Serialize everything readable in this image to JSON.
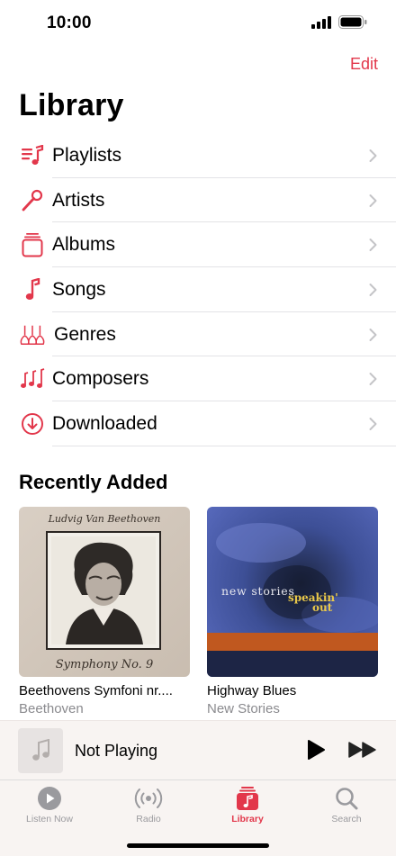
{
  "status": {
    "time": "10:00"
  },
  "header": {
    "edit_label": "Edit",
    "title": "Library"
  },
  "library_items": [
    {
      "label": "Playlists",
      "icon": "playlist-icon"
    },
    {
      "label": "Artists",
      "icon": "microphone-icon"
    },
    {
      "label": "Albums",
      "icon": "album-stack-icon"
    },
    {
      "label": "Songs",
      "icon": "music-note-icon"
    },
    {
      "label": "Genres",
      "icon": "guitars-icon"
    },
    {
      "label": "Composers",
      "icon": "notes-icon"
    },
    {
      "label": "Downloaded",
      "icon": "download-circle-icon"
    }
  ],
  "recently_added": {
    "title": "Recently Added",
    "albums": [
      {
        "title": "Beethovens Symfoni nr....",
        "artist": "Beethoven",
        "cover_top_text": "Ludvig Van Beethoven",
        "cover_bottom_text": "Symphony No. 9"
      },
      {
        "title": "Highway Blues",
        "artist": "New Stories",
        "cover_text_1": "new stories",
        "cover_text_2": "speakin'",
        "cover_text_3": "out"
      }
    ]
  },
  "mini_player": {
    "title": "Not Playing"
  },
  "tabs": [
    {
      "label": "Listen Now",
      "icon": "play-circle-icon",
      "active": false
    },
    {
      "label": "Radio",
      "icon": "radio-waves-icon",
      "active": false
    },
    {
      "label": "Library",
      "icon": "library-music-icon",
      "active": true
    },
    {
      "label": "Search",
      "icon": "search-icon",
      "active": false
    }
  ],
  "colors": {
    "accent": "#e2374b",
    "secondary_text": "#8a8a8e",
    "separator": "#e3e3e6"
  }
}
